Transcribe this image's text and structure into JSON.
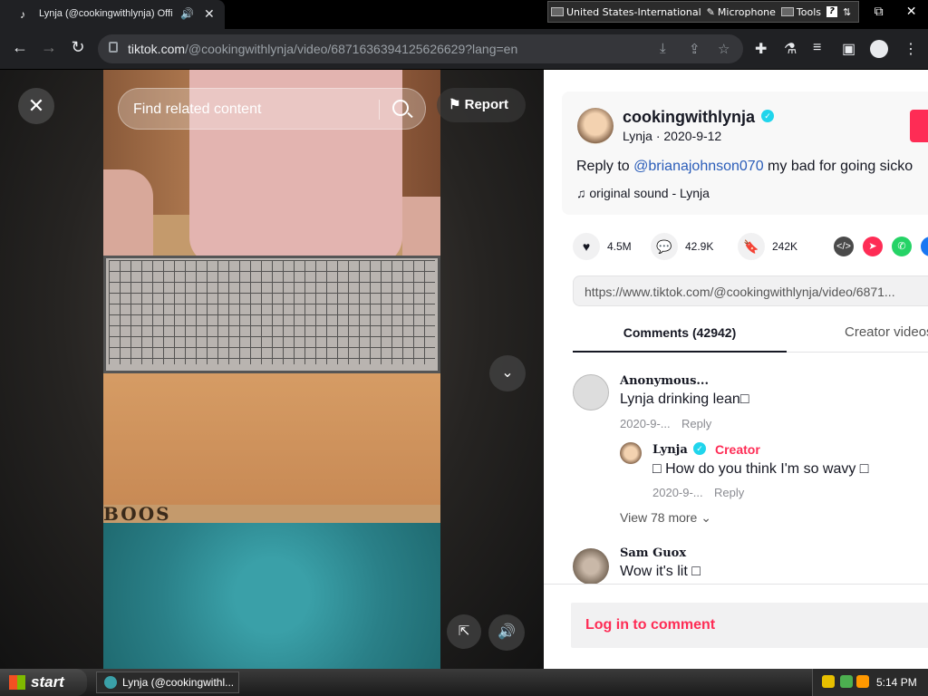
{
  "browser": {
    "tab_title": "Lynja (@cookingwithlynja) Offi",
    "url_host": "tiktok.com",
    "url_path": "/@cookingwithlynja/video/6871636394125626629?lang=en",
    "lang_bar": {
      "language": "United States-International",
      "microphone": "Microphone",
      "tools": "Tools"
    }
  },
  "video": {
    "search_placeholder": "Find related content",
    "report_label": "Report",
    "brand_text": "BOOS"
  },
  "post": {
    "username": "cookingwithlynja",
    "display_name_date": "Lynja · 2020-9-12",
    "description_prefix": "Reply to ",
    "mention": "@brianajohnson070",
    "description_suffix": " my bad for going sicko",
    "music": "original sound - Lynja",
    "likes": "4.5M",
    "comments": "42.9K",
    "saves": "242K",
    "share_link": "https://www.tiktok.com/@cookingwithlynja/video/6871..."
  },
  "tabs": {
    "comments": "Comments (42942)",
    "creator_videos": "Creator videos"
  },
  "comments": [
    {
      "name": "Anonymous...",
      "text": "Lynja drinking lean□",
      "date": "2020-9-...",
      "reply": "Reply"
    },
    {
      "name": "Lynja",
      "badge": "Creator",
      "text": "□ How do you think I'm so wavy □",
      "date": "2020-9-...",
      "reply": "Reply"
    },
    {
      "name": "Sam Guox",
      "text": "Wow it's lit □"
    }
  ],
  "view_more": "View 78 more",
  "login_label": "Log in to comment",
  "taskbar": {
    "start": "start",
    "item": "Lynja (@cookingwithl...",
    "clock": "5:14 PM"
  },
  "colors": {
    "accent": "#fe2c55",
    "link": "#2b5db9",
    "verified": "#20d5ec"
  }
}
